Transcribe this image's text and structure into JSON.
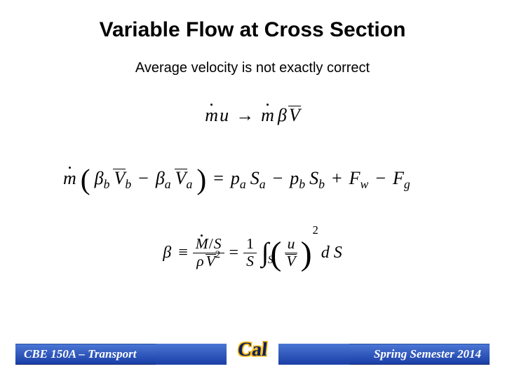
{
  "title": "Variable Flow at Cross Section",
  "subtitle": "Average velocity is not exactly correct",
  "symbols": {
    "mdot": "m",
    "u": "u",
    "beta": "β",
    "Vbar": "V",
    "arrow": "→",
    "rho": "ρ",
    "Mdot": "M",
    "slash": "/",
    "S": "S",
    "one": "1",
    "dS": "d S",
    "eq": "=",
    "minus": "−",
    "plus": "+",
    "defeq": "≡",
    "p": "p",
    "F": "F",
    "sub_a": "a",
    "sub_b": "b",
    "sub_w": "w",
    "sub_g": "g",
    "sub_S": "S",
    "sup2": "2"
  },
  "footer": {
    "left": "CBE 150A – Transport",
    "right": "Spring Semester 2014",
    "logo": "Cal"
  }
}
